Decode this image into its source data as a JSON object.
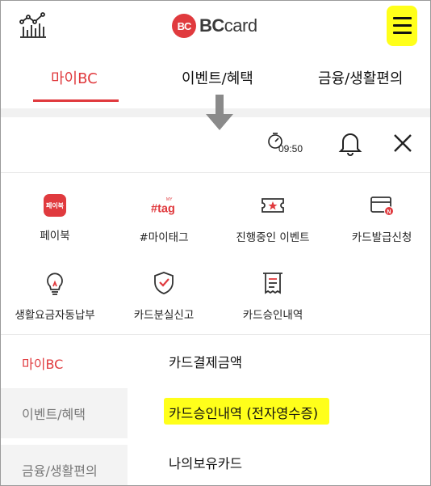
{
  "header": {
    "logo_mark": "BC",
    "logo_text_bold": "BC",
    "logo_text_rest": "card",
    "icons": {
      "left": "chart-icon",
      "right": "hamburger-menu-icon"
    },
    "menu_highlight_color": "#ffff1a"
  },
  "main_tabs": [
    {
      "label": "마이BC",
      "active": true
    },
    {
      "label": "이벤트/혜택",
      "active": false
    },
    {
      "label": "금융/생활편의",
      "active": false
    }
  ],
  "toolbar": {
    "session_time": "09:50",
    "icons": [
      "timer-icon",
      "bell-icon",
      "close-icon"
    ]
  },
  "quick_menu": [
    {
      "label": "페이북",
      "icon": "paybook-icon",
      "icon_text": "페이북"
    },
    {
      "label": "#마이태그",
      "icon": "mytag-icon",
      "icon_text": "#tag",
      "icon_sup": "MY"
    },
    {
      "label": "진행중인 이벤트",
      "icon": "ticket-icon"
    },
    {
      "label": "카드발급신청",
      "icon": "card-apply-icon"
    },
    {
      "label": "생활요금자동납부",
      "icon": "lightbulb-icon"
    },
    {
      "label": "카드분실신고",
      "icon": "shield-check-icon"
    },
    {
      "label": "카드승인내역",
      "icon": "receipt-icon"
    }
  ],
  "side_nav": [
    {
      "label": "마이BC",
      "active": true
    },
    {
      "label": "이벤트/혜택",
      "active": false
    },
    {
      "label": "금융/생활편의",
      "active": false
    }
  ],
  "sub_menu": [
    {
      "label": "카드결제금액",
      "highlighted": false
    },
    {
      "label": "카드승인내역 (전자영수증)",
      "highlighted": true
    },
    {
      "label": "나의보유카드",
      "highlighted": false
    }
  ],
  "colors": {
    "brand_red": "#e03a3e",
    "highlight_yellow": "#ffff1a",
    "arrow_gray": "#8a8a8a"
  }
}
